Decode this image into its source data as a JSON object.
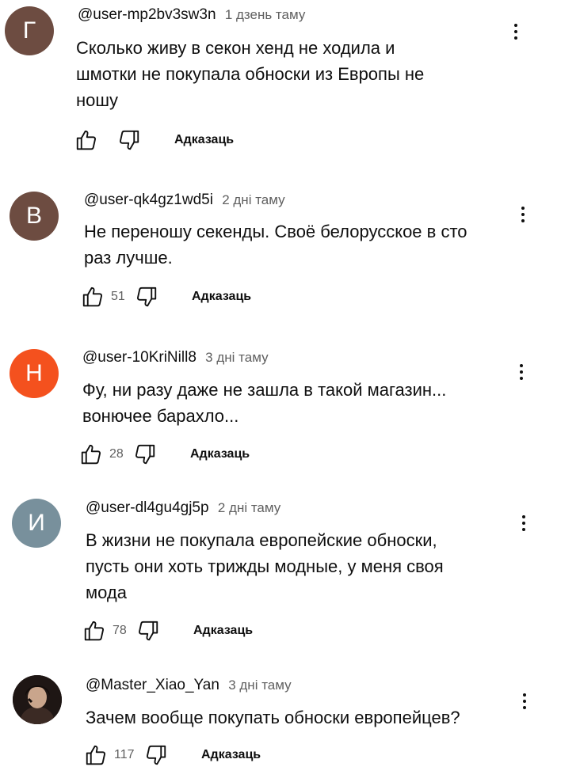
{
  "comments": [
    {
      "author": "@user-mp2bv3sw3n",
      "time": "1 дзень таму",
      "avatar_letter": "Г",
      "avatar_color": "#6d4c41",
      "text_lines": [
        "Сколько живу в секон хенд не ходила и",
        "шмотки не покупала обноски  из Европы не",
        "ношу"
      ],
      "likes": "",
      "reply_label": "Адказаць"
    },
    {
      "author": "@user-qk4gz1wd5i",
      "time": "2 дні таму",
      "avatar_letter": "В",
      "avatar_color": "#6d4c41",
      "text_lines": [
        "Не переношу секенды. Своё белорусское в сто",
        "раз лучше."
      ],
      "likes": "51",
      "reply_label": "Адказаць"
    },
    {
      "author": "@user-10KriNill8",
      "time": "3 дні таму",
      "avatar_letter": "Н",
      "avatar_color": "#f4511e",
      "text_lines": [
        "Фу, ни разу даже не зашла в такой магазин...",
        "вонючее барахло..."
      ],
      "likes": "28",
      "reply_label": "Адказаць"
    },
    {
      "author": "@user-dl4gu4gj5p",
      "time": "2 дні таму",
      "avatar_letter": "И",
      "avatar_color": "#78909c",
      "text_lines": [
        "В жизни не покупала европейские обноски,",
        "пусть они хоть трижды модные, у меня своя",
        "мода"
      ],
      "likes": "78",
      "reply_label": "Адказаць"
    },
    {
      "author": "@Master_Xiao_Yan",
      "time": "3 дні таму",
      "avatar_letter": "",
      "avatar_color": "#2b1d1a",
      "text_lines": [
        "Зачем вообще покупать обноски европейцев?"
      ],
      "likes": "117",
      "reply_label": "Адказаць"
    }
  ],
  "icons": {
    "like": "thumb-up-outline-icon",
    "dislike": "thumb-down-outline-icon",
    "menu": "more-vertical-icon"
  }
}
